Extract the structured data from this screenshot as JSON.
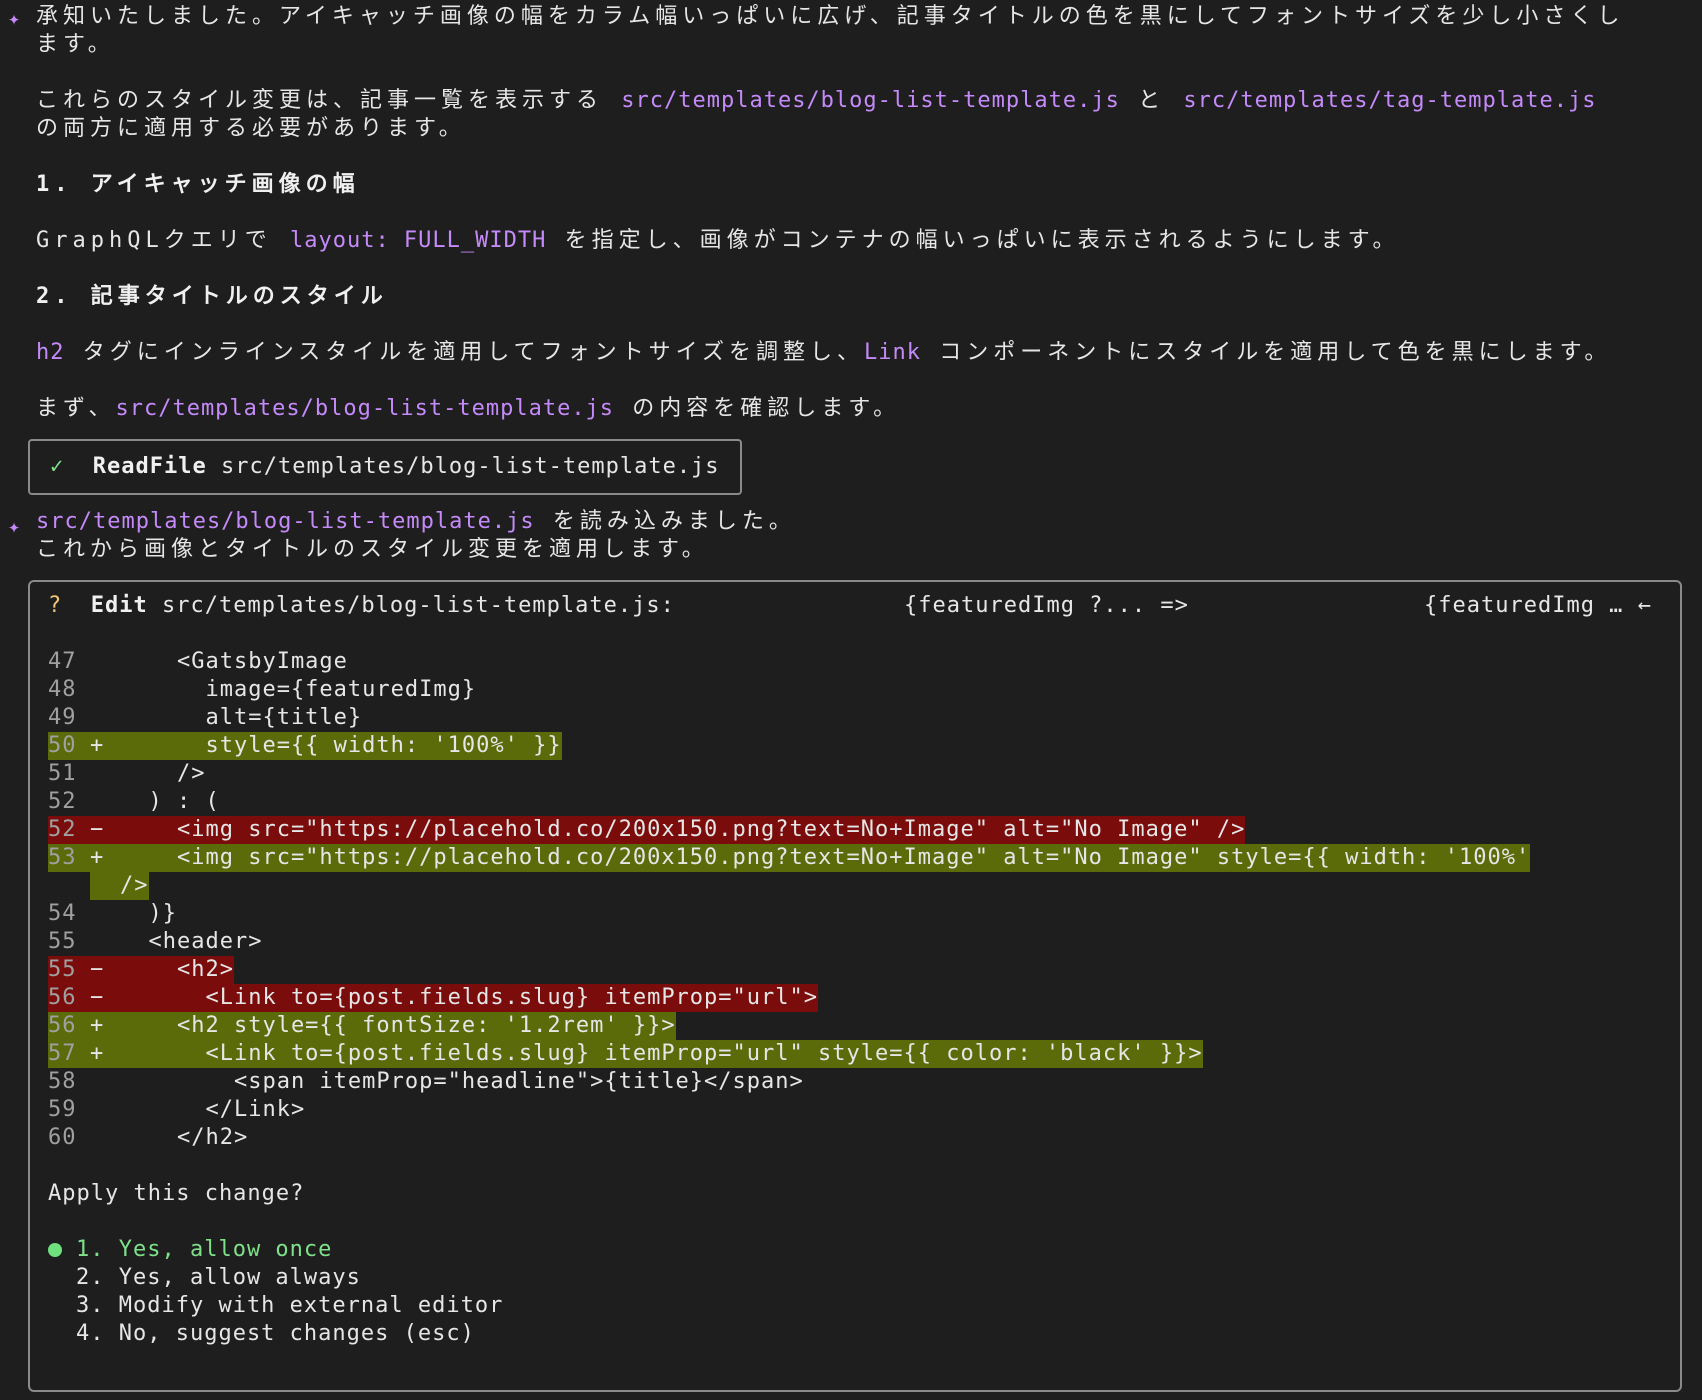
{
  "messages": {
    "m1_line1": "承知いたしました。アイキャッチ画像の幅をカラム幅いっぱいに広げ、記事タイトルの色を黒にしてフォントサイズを少し小さくし",
    "m1_line2": "ます。",
    "m2_pre": "これらのスタイル変更は、記事一覧を表示する ",
    "m2_code1": "src/templates/blog-list-template.js",
    "m2_mid": " と ",
    "m2_code2": "src/templates/tag-template.js",
    "m2_line2": "の両方に適用する必要があります。",
    "h1": "1. アイキャッチ画像の幅",
    "p1_pre": "GraphQLクエリで ",
    "p1_code": "layout: FULL_WIDTH",
    "p1_post": " を指定し、画像がコンテナの幅いっぱいに表示されるようにします。",
    "h2": "2. 記事タイトルのスタイル",
    "p2_code1": "h2",
    "p2_mid": " タグにインラインスタイルを適用してフォントサイズを調整し、",
    "p2_code2": "Link",
    "p2_post": " コンポーネントにスタイルを適用して色を黒にします。",
    "p3_pre": "まず、",
    "p3_code": "src/templates/blog-list-template.js",
    "p3_post": " の内容を確認します。",
    "m3_code": "src/templates/blog-list-template.js",
    "m3_post": " を読み込みました。",
    "m3_line2": "これから画像とタイトルのスタイル変更を適用します。"
  },
  "tool_call": {
    "check": "✓",
    "name": "ReadFile",
    "path": "src/templates/blog-list-template.js"
  },
  "edit": {
    "marker": "?",
    "action": "Edit",
    "path": "src/templates/blog-list-template.js:",
    "old_snippet": "{featuredImg ?... =>",
    "new_snippet": "{featuredImg …",
    "arrow": "←",
    "prompt": "Apply this change?",
    "options": [
      "1. Yes, allow once",
      "2. Yes, allow always",
      "3. Modify with external editor",
      "4. No, suggest changes (esc)"
    ],
    "selected_index": 0,
    "diff": [
      {
        "ln": "47",
        "mk": "",
        "type": "ctx",
        "text": "    <GatsbyImage"
      },
      {
        "ln": "48",
        "mk": "",
        "type": "ctx",
        "text": "      image={featuredImg}"
      },
      {
        "ln": "49",
        "mk": "",
        "type": "ctx",
        "text": "      alt={title}"
      },
      {
        "ln": "50",
        "mk": "+",
        "type": "add",
        "text": "      style={{ width: '100%' }}"
      },
      {
        "ln": "51",
        "mk": "",
        "type": "ctx",
        "text": "    />"
      },
      {
        "ln": "52",
        "mk": "",
        "type": "ctx",
        "text": "  ) : ("
      },
      {
        "ln": "52",
        "mk": "−",
        "type": "del",
        "text": "    <img src=\"https://placehold.co/200x150.png?text=No+Image\" alt=\"No Image\" />"
      },
      {
        "ln": "53",
        "mk": "+",
        "type": "add",
        "text": "    <img src=\"https://placehold.co/200x150.png?text=No+Image\" alt=\"No Image\" style={{ width: '100%'"
      },
      {
        "ln": "",
        "mk": "",
        "type": "add",
        "text": "/>"
      },
      {
        "ln": "54",
        "mk": "",
        "type": "ctx",
        "text": "  )}"
      },
      {
        "ln": "55",
        "mk": "",
        "type": "ctx",
        "text": "  <header>"
      },
      {
        "ln": "55",
        "mk": "−",
        "type": "del",
        "text": "    <h2>"
      },
      {
        "ln": "56",
        "mk": "−",
        "type": "del",
        "text": "      <Link to={post.fields.slug} itemProp=\"url\">"
      },
      {
        "ln": "56",
        "mk": "+",
        "type": "add",
        "text": "    <h2 style={{ fontSize: '1.2rem' }}>"
      },
      {
        "ln": "57",
        "mk": "+",
        "type": "add",
        "text": "      <Link to={post.fields.slug} itemProp=\"url\" style={{ color: 'black' }}>"
      },
      {
        "ln": "58",
        "mk": "",
        "type": "ctx",
        "text": "        <span itemProp=\"headline\">{title}</span>"
      },
      {
        "ln": "59",
        "mk": "",
        "type": "ctx",
        "text": "      </Link>"
      },
      {
        "ln": "60",
        "mk": "",
        "type": "ctx",
        "text": "    </h2>"
      }
    ]
  },
  "icons": {
    "agent_star": "✦"
  },
  "colors": {
    "background": "#1e1e1e",
    "code_accent": "#c58af9",
    "added_bg": "#5b6b0a",
    "removed_bg": "#7a0c0c",
    "selected_option": "#7fe08a"
  }
}
